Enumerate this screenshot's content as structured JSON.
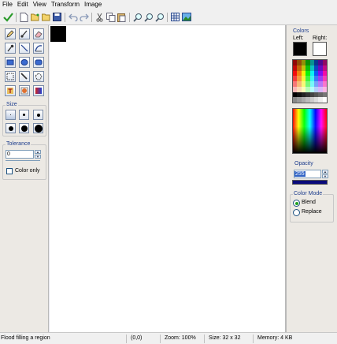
{
  "menu": [
    "File",
    "Edit",
    "View",
    "Transform",
    "Image"
  ],
  "toolbar_icons": [
    "check-icon",
    "new-icon",
    "open-icon",
    "open-folder-icon",
    "save-icon",
    "undo-icon",
    "redo-icon",
    "cut-icon",
    "copy-icon",
    "paste-icon",
    "zoom-in-icon",
    "zoom-out-icon",
    "zoom-actual-icon",
    "grid-icon",
    "image-icon"
  ],
  "tools": [
    "pencil-icon",
    "brush-icon",
    "eraser-icon",
    "color-picker-icon",
    "line-icon",
    "curve-icon",
    "rectangle-icon",
    "ellipse-icon",
    "rounded-rect-icon",
    "rect-select-icon",
    "magic-wand-icon",
    "lasso-icon",
    "text-icon",
    "paint-bucket-icon",
    "gradient-icon"
  ],
  "size": {
    "title": "Size"
  },
  "tolerance": {
    "title": "Tolerance",
    "value": "0",
    "color_only_label": "Color only"
  },
  "colors": {
    "title": "Colors",
    "left_label": "Left:",
    "right_label": "Right:",
    "left_color": "#000000",
    "right_color": "#ffffff"
  },
  "opacity": {
    "title": "Opacity",
    "value": "255"
  },
  "color_mode": {
    "title": "Color Mode",
    "blend_label": "Blend",
    "replace_label": "Replace",
    "selected": "Blend"
  },
  "status": {
    "message": "Flood filling a region",
    "position": "(0,0)",
    "zoom": "Zoom: 100%",
    "size": "Size: 32 x 32",
    "memory": "Memory: 4 KB"
  }
}
